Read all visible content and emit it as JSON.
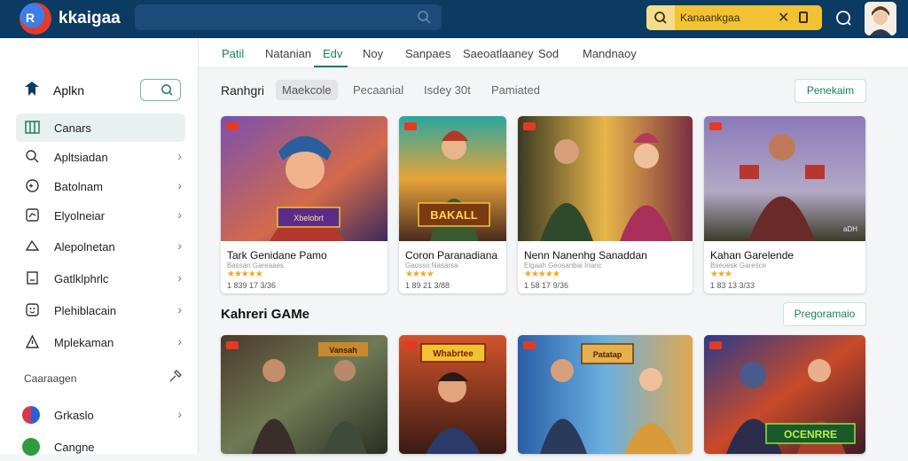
{
  "header": {
    "brand": "kkaigaa",
    "logo_text": "R",
    "search_pill_text": "Kanaankgaa"
  },
  "sidebar": {
    "title": "Aplkn",
    "items": [
      {
        "label": "Canars",
        "icon": "grid-icon",
        "active": true
      },
      {
        "label": "Apltsiadan",
        "icon": "search-icon"
      },
      {
        "label": "Batolnam",
        "icon": "gamepad-icon"
      },
      {
        "label": "Elyolneiar",
        "icon": "chart-icon"
      },
      {
        "label": "Alepolnetan",
        "icon": "cloud-icon"
      },
      {
        "label": "Gatlklphrlc",
        "icon": "document-icon"
      },
      {
        "label": "Plehiblacain",
        "icon": "smile-icon"
      },
      {
        "label": "Mplekaman",
        "icon": "people-icon"
      }
    ],
    "section_label": "Caaraagen",
    "bottom_items": [
      {
        "label": "Grkaslo",
        "color": "#c53a4a"
      },
      {
        "label": "Cangne",
        "color": "#2e9b3d"
      }
    ]
  },
  "tabs": [
    "Patil",
    "Natanian",
    "Edv",
    "Noy",
    "Sanpaes",
    "Saeoatlaaney",
    "Sod",
    "Mandnaoy"
  ],
  "filters": {
    "heading": "Ranhgri",
    "options": [
      "Maekcole",
      "Pecaanial",
      "Isdey 30t",
      "Pamiated"
    ],
    "action": "Penekaim"
  },
  "cards_row1": [
    {
      "title": "Tark Genidane Pamo",
      "sub": "Bassan Gareaaes",
      "rating": "★★★★★",
      "meta": "1 839 17 3/36",
      "art_text": "Xbelobrt"
    },
    {
      "title": "Coron Paranadiana",
      "sub": "Gaosso Nasarsa",
      "rating": "★★★★",
      "meta": "1 89 21 3/88",
      "art_text": "BAKALL"
    },
    {
      "title": "Nenn Nanenhg Sanaddan",
      "sub": "Elgaah Geosanbai Inanc",
      "rating": "★★★★★",
      "meta": "1 58 17 9/36",
      "art_text": ""
    },
    {
      "title": "Kahan Garelende",
      "sub": "Bseoesk Garesce",
      "rating": "★★★",
      "meta": "1 83 13 3/33",
      "art_text": "aDH"
    }
  ],
  "section2": {
    "heading": "Kahreri GAMe",
    "action": "Pregoramaio"
  },
  "cards_row2": [
    {
      "art_text": "Vansah"
    },
    {
      "art_text": "Whabrtee"
    },
    {
      "art_text": "Patatap"
    },
    {
      "art_text": "OCENRRE"
    }
  ],
  "colors": {
    "topbar": "#0b3a63",
    "accent": "#1a7f5a",
    "pill": "#f1c232"
  }
}
